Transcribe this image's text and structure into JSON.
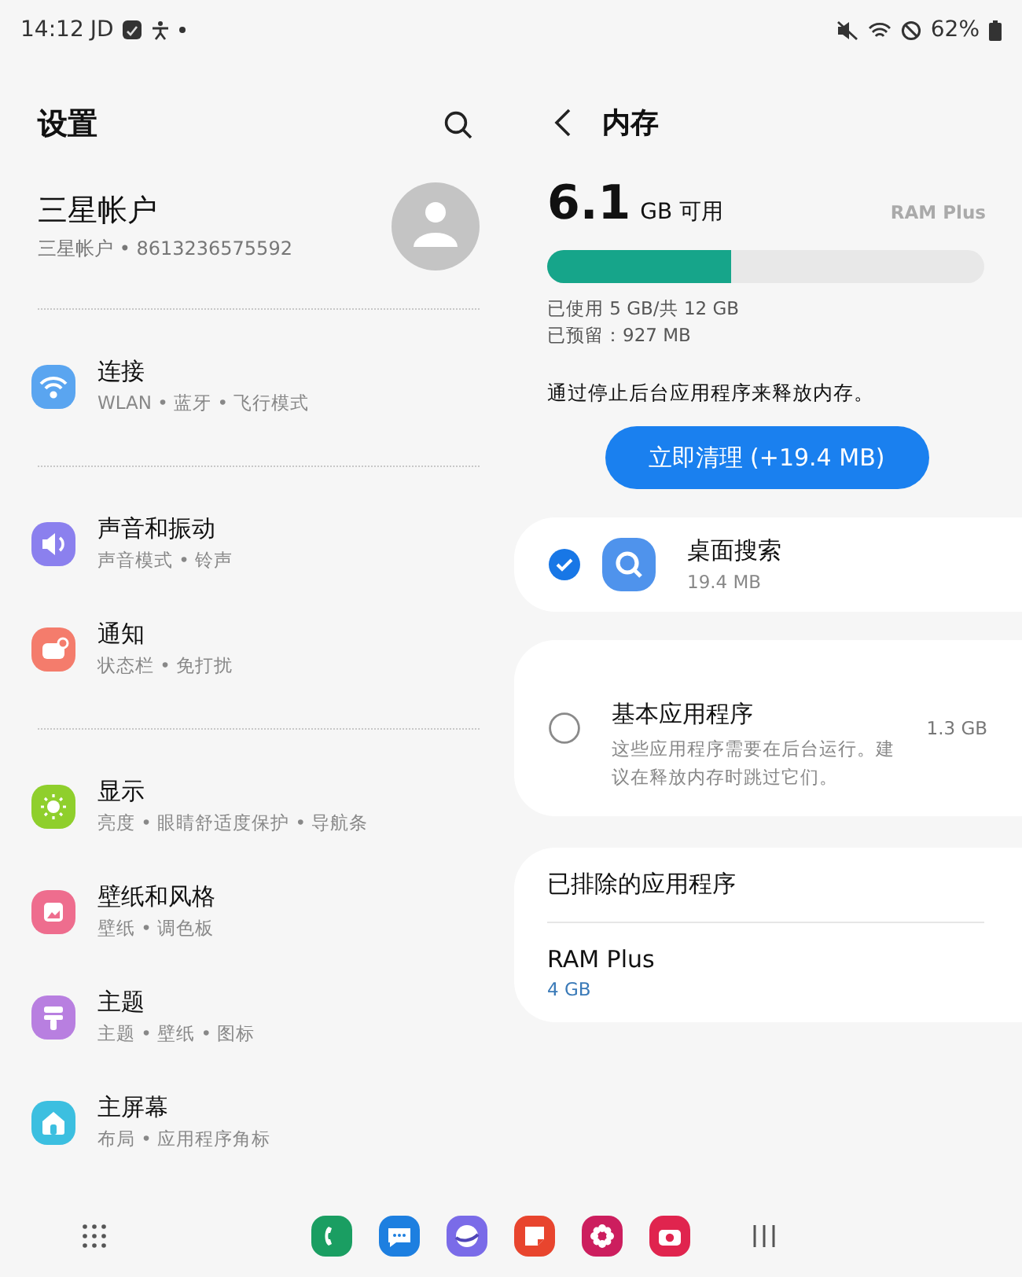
{
  "status_bar": {
    "time": "14:12",
    "carrier": "JD",
    "battery": "62%"
  },
  "settings": {
    "title": "设置",
    "account": {
      "name": "三星帐户",
      "detail": "三星帐户 • 8613236575592"
    },
    "groups": [
      [
        {
          "title": "连接",
          "subtitle": "WLAN • 蓝牙 • 飞行模式"
        }
      ],
      [
        {
          "title": "声音和振动",
          "subtitle": "声音模式 • 铃声"
        },
        {
          "title": "通知",
          "subtitle": "状态栏 • 免打扰"
        }
      ],
      [
        {
          "title": "显示",
          "subtitle": "亮度 • 眼睛舒适度保护 • 导航条"
        },
        {
          "title": "壁纸和风格",
          "subtitle": "壁纸 • 调色板"
        },
        {
          "title": "主题",
          "subtitle": "主题 • 壁纸 • 图标"
        },
        {
          "title": "主屏幕",
          "subtitle": "布局 • 应用程序角标"
        }
      ]
    ]
  },
  "memory": {
    "title": "内存",
    "available": "6.1",
    "available_unit": "GB 可用",
    "ram_plus_link": "RAM Plus",
    "level": 0.42,
    "used": "已使用 5 GB/共 12 GB",
    "reserved": "已预留：927 MB",
    "description": "通过停止后台应用程序来释放内存。",
    "clean_button": "立即清理 (+19.4 MB)",
    "apps": [
      {
        "kind": "app",
        "checked": true,
        "name": "桌面搜索",
        "size": "19.4 MB"
      },
      {
        "kind": "group",
        "checked": false,
        "name": "基本应用程序",
        "description": "这些应用程序需要在后台运行。建议在释放内存时跳过它们。",
        "size": "1.3 GB"
      }
    ],
    "excluded": {
      "title": "已排除的应用程序",
      "items": [
        {
          "name": "RAM Plus",
          "value": "4 GB"
        }
      ]
    }
  }
}
